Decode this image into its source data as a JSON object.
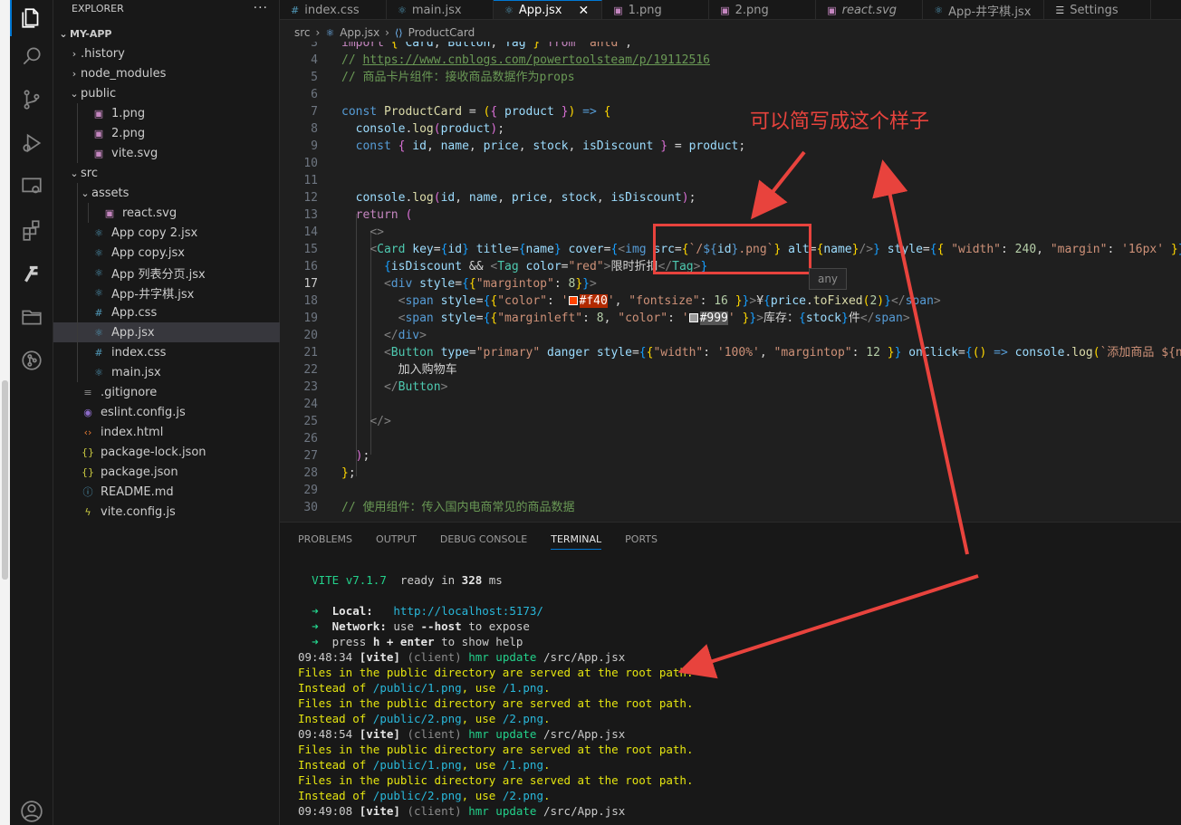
{
  "explorer": {
    "title": "EXPLORER",
    "more": "···",
    "root": "MY-APP",
    "items": [
      {
        "label": ".history",
        "type": "folder",
        "open": false,
        "depth": 1
      },
      {
        "label": "node_modules",
        "type": "folder",
        "open": false,
        "depth": 1
      },
      {
        "label": "public",
        "type": "folder",
        "open": true,
        "depth": 1
      },
      {
        "label": "1.png",
        "type": "image",
        "depth": 2
      },
      {
        "label": "2.png",
        "type": "image",
        "depth": 2
      },
      {
        "label": "vite.svg",
        "type": "svg",
        "depth": 2
      },
      {
        "label": "src",
        "type": "folder",
        "open": true,
        "depth": 1
      },
      {
        "label": "assets",
        "type": "folder",
        "open": true,
        "depth": 2
      },
      {
        "label": "react.svg",
        "type": "svg",
        "depth": 3
      },
      {
        "label": "App copy 2.jsx",
        "type": "react",
        "depth": 2
      },
      {
        "label": "App copy.jsx",
        "type": "react",
        "depth": 2
      },
      {
        "label": "App 列表分页.jsx",
        "type": "react",
        "depth": 2
      },
      {
        "label": "App-井字棋.jsx",
        "type": "react",
        "depth": 2
      },
      {
        "label": "App.css",
        "type": "css",
        "depth": 2
      },
      {
        "label": "App.jsx",
        "type": "react",
        "depth": 2,
        "selected": true
      },
      {
        "label": "index.css",
        "type": "css",
        "depth": 2
      },
      {
        "label": "main.jsx",
        "type": "react",
        "depth": 2
      },
      {
        "label": ".gitignore",
        "type": "text",
        "depth": 1
      },
      {
        "label": "eslint.config.js",
        "type": "eslint",
        "depth": 1
      },
      {
        "label": "index.html",
        "type": "html",
        "depth": 1
      },
      {
        "label": "package-lock.json",
        "type": "json",
        "depth": 1
      },
      {
        "label": "package.json",
        "type": "json",
        "depth": 1
      },
      {
        "label": "README.md",
        "type": "info",
        "depth": 1
      },
      {
        "label": "vite.config.js",
        "type": "vite",
        "depth": 1
      }
    ]
  },
  "tabs": [
    {
      "label": "index.css",
      "icon": "#"
    },
    {
      "label": "main.jsx",
      "icon": "⚛"
    },
    {
      "label": "App.jsx",
      "icon": "⚛",
      "active": true,
      "close": "✕"
    },
    {
      "label": "1.png",
      "icon": "▣"
    },
    {
      "label": "2.png",
      "icon": "▣"
    },
    {
      "label": "react.svg",
      "icon": "▣",
      "italic": true
    },
    {
      "label": "App-井字棋.jsx",
      "icon": "⚛"
    },
    {
      "label": "Settings",
      "icon": "☰"
    }
  ],
  "breadcrumb": {
    "folder": "src",
    "file": "App.jsx",
    "symbol": "ProductCard"
  },
  "editor": {
    "line_numbers": [
      "3",
      "4",
      "5",
      "6",
      "7",
      "8",
      "9",
      "10",
      "11",
      "12",
      "13",
      "14",
      "15",
      "16",
      "17",
      "18",
      "19",
      "20",
      "21",
      "22",
      "23",
      "24",
      "25",
      "26",
      "27",
      "28",
      "29",
      "30"
    ],
    "current_line": "17",
    "hover_tooltip": "any",
    "l3": "import { Card, Button, Tag } from 'antd';",
    "l4_prefix": "// ",
    "l4_link": "https://www.cnblogs.com/powertoolsteam/p/19112516",
    "l5": "// 商品卡片组件：接收商品数据作为props",
    "l17_color1": "#f40",
    "l18_color2": "#999",
    "l16_text": "限时折扣",
    "l18_text": "库存：",
    "l18_unit": "件",
    "l21_text": "`添加商品 ${nam",
    "l22_text": "加入购物车",
    "l30": "// 使用组件：传入国内电商常见的商品数据"
  },
  "panel": {
    "tabs": [
      "PROBLEMS",
      "OUTPUT",
      "DEBUG CONSOLE",
      "TERMINAL",
      "PORTS"
    ],
    "active_tab": "TERMINAL"
  },
  "terminal": {
    "vite": "VITE",
    "version": "v7.1.7",
    "ready": "ready in",
    "ms_value": "328",
    "ms": "ms",
    "local_label": "Local:",
    "local_url": "http://localhost:5173/",
    "network_label": "Network:",
    "network_use": "use",
    "network_flag": "--host",
    "network_rest": "to expose",
    "press": "press",
    "press_key": "h + enter",
    "press_rest": "to show help",
    "log": [
      {
        "kind": "hmr",
        "time": "09:48:34",
        "path": "/src/App.jsx"
      },
      {
        "kind": "warn",
        "text": "Files in the public directory are served at the root path."
      },
      {
        "kind": "instead",
        "from": "/public/1.png",
        "to": "/1.png"
      },
      {
        "kind": "warn",
        "text": "Files in the public directory are served at the root path."
      },
      {
        "kind": "instead",
        "from": "/public/2.png",
        "to": "/2.png"
      },
      {
        "kind": "hmr",
        "time": "09:48:54",
        "path": "/src/App.jsx"
      },
      {
        "kind": "warn",
        "text": "Files in the public directory are served at the root path."
      },
      {
        "kind": "instead",
        "from": "/public/1.png",
        "to": "/1.png"
      },
      {
        "kind": "warn",
        "text": "Files in the public directory are served at the root path."
      },
      {
        "kind": "instead",
        "from": "/public/2.png",
        "to": "/2.png"
      },
      {
        "kind": "hmr",
        "time": "09:49:08",
        "path": "/src/App.jsx"
      }
    ],
    "tag": "[vite]",
    "client": "(client)",
    "hmr": "hmr update",
    "instead_of": "Instead of",
    "use": "use"
  },
  "annotation": {
    "note": "可以简写成这个样子",
    "color": "#e8433d"
  }
}
